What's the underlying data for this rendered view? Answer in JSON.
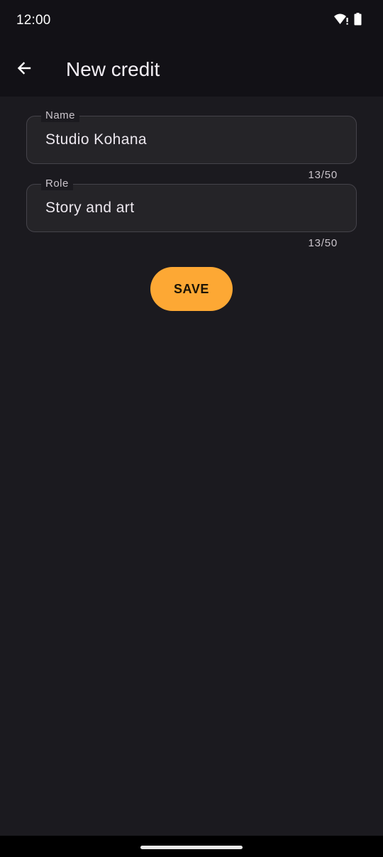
{
  "status_bar": {
    "time": "12:00",
    "icons": [
      "wifi-alert-icon",
      "battery-icon"
    ]
  },
  "app_bar": {
    "back_icon": "arrow-back-icon",
    "title": "New credit"
  },
  "form": {
    "name": {
      "label": "Name",
      "value": "Studio Kohana",
      "counter": "13/50"
    },
    "role": {
      "label": "Role",
      "value": "Story and art",
      "counter": "13/50"
    },
    "save_label": "SAVE"
  },
  "colors": {
    "accent": "#fda834",
    "background": "#1b1a1f",
    "app_bar": "#121116"
  }
}
